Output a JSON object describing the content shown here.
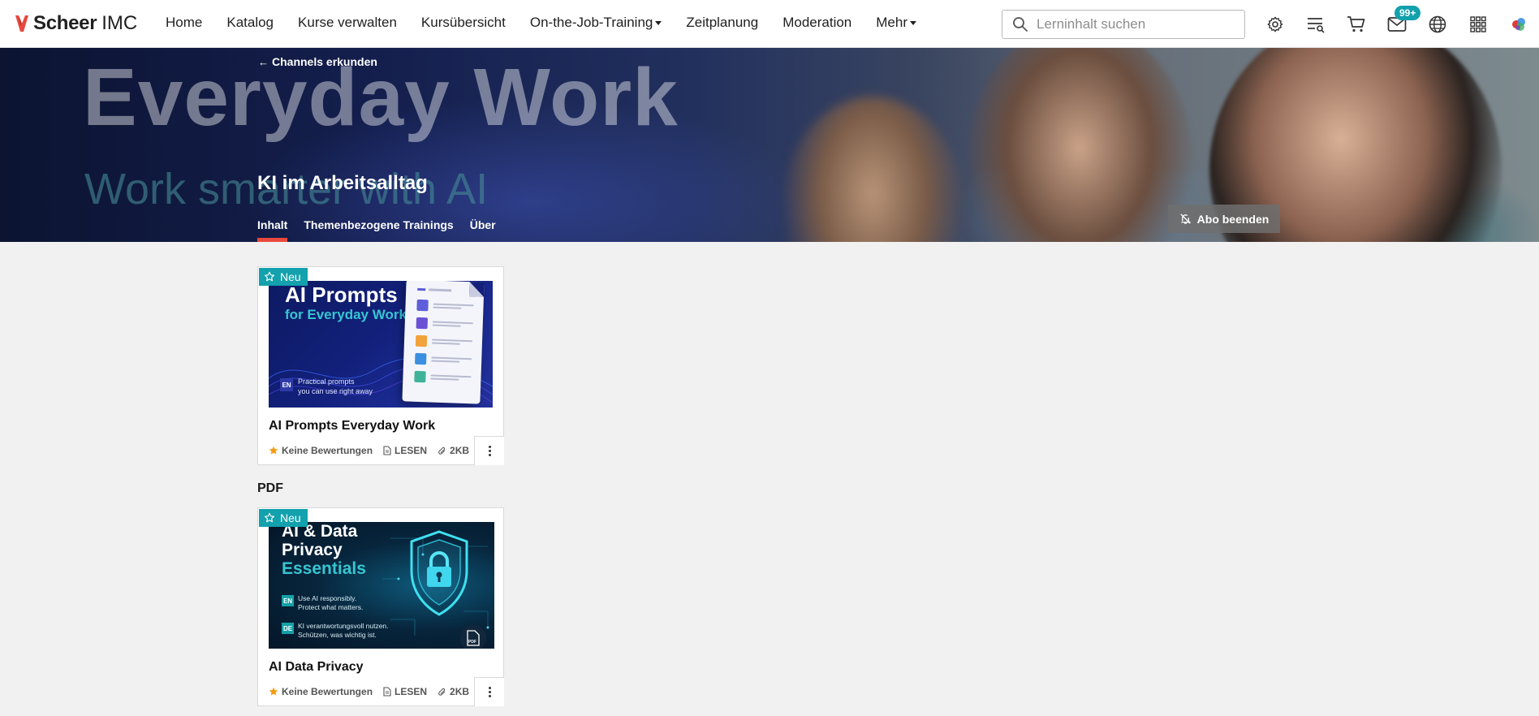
{
  "brand": {
    "name_bold": "Scheer",
    "name_regular": "IMC",
    "accent": "#e8493e"
  },
  "nav": {
    "items": [
      {
        "label": "Home",
        "dropdown": false
      },
      {
        "label": "Katalog",
        "dropdown": false
      },
      {
        "label": "Kurse verwalten",
        "dropdown": false
      },
      {
        "label": "Kursübersicht",
        "dropdown": false
      },
      {
        "label": "On-the-Job-Training",
        "dropdown": true
      },
      {
        "label": "Zeitplanung",
        "dropdown": false
      },
      {
        "label": "Moderation",
        "dropdown": false
      },
      {
        "label": "Mehr",
        "dropdown": true
      }
    ]
  },
  "search": {
    "placeholder": "Lerninhalt suchen",
    "value": ""
  },
  "toolbar": {
    "icons": [
      "gear-icon",
      "learning-path-icon",
      "cart-icon",
      "mail-icon",
      "globe-icon",
      "apps-grid-icon",
      "profile-logo-icon"
    ],
    "mail_badge": "99+",
    "badge_color": "#12a1ad"
  },
  "banner": {
    "back_label": "Channels erkunden",
    "image_headline": "Everyday Work",
    "image_subline": "Work smarter with AI",
    "channel_title": "KI im Arbeitsalltag",
    "tabs": [
      {
        "label": "Inhalt",
        "active": true
      },
      {
        "label": "Themenbezogene Trainings",
        "active": false
      },
      {
        "label": "Über",
        "active": false
      }
    ],
    "unsubscribe_label": "Abo beenden"
  },
  "section_label": "PDF",
  "cards": [
    {
      "badge": "Neu",
      "thumb": {
        "title": "AI Prompts",
        "subtitle": "for Everyday Work",
        "lang": "EN",
        "caption_line1": "Practical prompts",
        "caption_line2": "you can use right away"
      },
      "title": "AI Prompts Everyday Work",
      "rating": "Keine Bewertungen",
      "type": "LESEN",
      "size": "2KB"
    },
    {
      "badge": "Neu",
      "thumb": {
        "title_line1": "AI & Data",
        "title_line2": "Privacy",
        "subtitle": "Essentials",
        "lang1": "EN",
        "lang1_line1": "Use AI responsibly.",
        "lang1_line2": "Protect what matters.",
        "lang2": "DE",
        "lang2_line1": "KI verantwortungsvoll nutzen.",
        "lang2_line2": "Schützen, was wichtig ist.",
        "file_label": "PDF"
      },
      "title": "AI Data Privacy",
      "rating": "Keine Bewertungen",
      "type": "LESEN",
      "size": "2KB"
    }
  ]
}
